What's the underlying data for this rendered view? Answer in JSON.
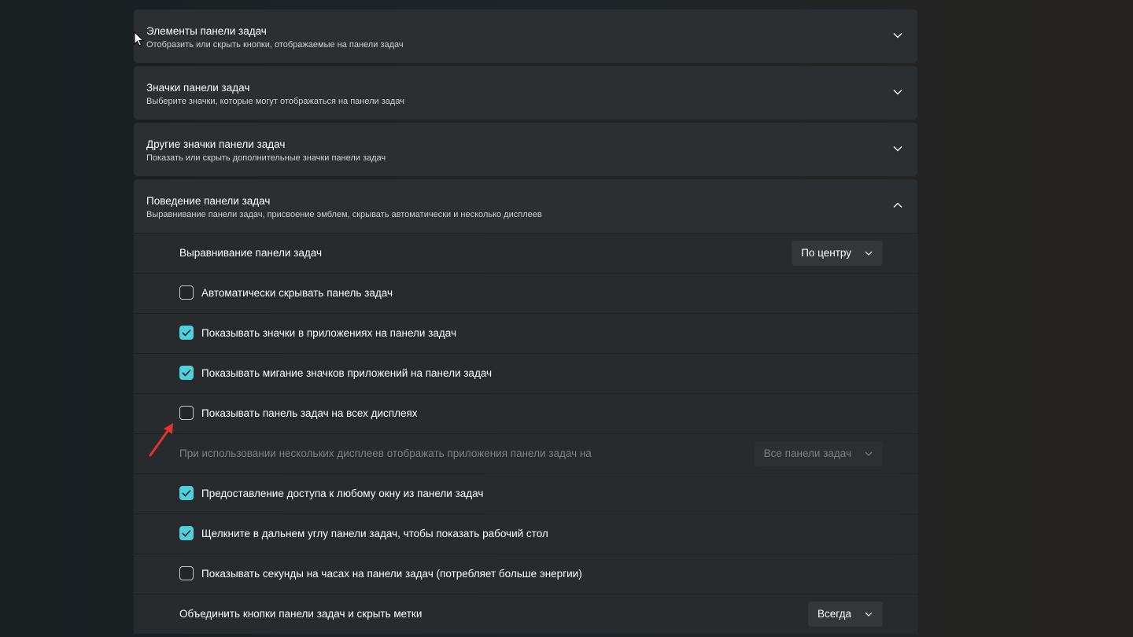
{
  "sections": [
    {
      "title": "Элементы панели задач",
      "subtitle": "Отобразить или скрыть кнопки, отображаемые на панели задач",
      "expanded": false
    },
    {
      "title": "Значки панели задач",
      "subtitle": "Выберите значки, которые могут отображаться на панели задач",
      "expanded": false
    },
    {
      "title": "Другие значки панели задач",
      "subtitle": "Показать или скрыть дополнительные значки панели задач",
      "expanded": false
    },
    {
      "title": "Поведение панели задач",
      "subtitle": "Выравнивание панели задач, присвоение эмблем, скрывать автоматически и несколько дисплеев",
      "expanded": true
    }
  ],
  "behavior": {
    "alignment": {
      "label": "Выравнивание панели задач",
      "value": "По центру"
    },
    "autohide": {
      "label": "Автоматически скрывать панель задач",
      "checked": false
    },
    "badges": {
      "label": "Показывать значки в приложениях на панели задач",
      "checked": true
    },
    "flashing": {
      "label": "Показывать мигание значков приложений на панели задач",
      "checked": true
    },
    "all_displays": {
      "label": "Показывать панель задач на всех дисплеях",
      "checked": false
    },
    "multi_display": {
      "label": "При использовании нескольких дисплеев отображать приложения панели задач на",
      "value": "Все панели задач",
      "disabled": true
    },
    "share_window": {
      "label": "Предоставление доступа к любому окну из панели задач",
      "checked": true
    },
    "far_corner": {
      "label": "Щелкните в дальнем углу панели задач, чтобы показать рабочий стол",
      "checked": true
    },
    "seconds": {
      "label": "Показывать секунды на часах на панели задач (потребляет больше энергии)",
      "checked": false
    },
    "combine": {
      "label": "Объединить кнопки панели задач и скрыть метки",
      "value": "Всегда"
    }
  },
  "colors": {
    "accent": "#4fd1dd",
    "annotation_arrow": "#e0342c"
  },
  "icons": {
    "collapsed": "chevron-down-icon",
    "expanded": "chevron-up-icon",
    "check": "checkmark-icon",
    "pointer": "mouse-cursor-icon",
    "annotation": "red-arrow-icon"
  }
}
